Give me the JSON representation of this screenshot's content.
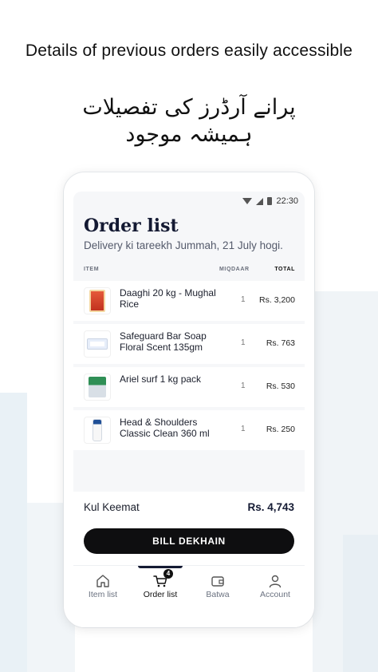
{
  "headline": {
    "english": "Details of previous orders easily accessible",
    "urdu_line1": "پرانے آرڈرز کی تفصیلات",
    "urdu_line2": "ہمیشہ موجود"
  },
  "status_bar": {
    "time": "22:30",
    "icons": [
      "wifi-icon",
      "cell-signal-icon",
      "battery-icon"
    ]
  },
  "screen": {
    "title": "Order list",
    "subtitle": "Delivery ki tareekh Jummah, 21 July hogi."
  },
  "table": {
    "headers": {
      "item": "ITEM",
      "qty": "MIQDAAR",
      "total": "TOTAL"
    },
    "rows": [
      {
        "name": "Daaghi 20 kg - Mughal Rice",
        "qty": "1",
        "price": "Rs. 3,200",
        "thumb_color": "#d9442f"
      },
      {
        "name": "Safeguard Bar Soap Floral Scent 135gm",
        "qty": "1",
        "price": "Rs. 763",
        "thumb_color": "#3f6fb5"
      },
      {
        "name": "Ariel surf 1 kg pack",
        "qty": "1",
        "price": "Rs. 530",
        "thumb_color": "#2f8f55"
      },
      {
        "name": "Head & Shoulders Classic Clean 360 ml",
        "qty": "1",
        "price": "Rs. 250",
        "thumb_color": "#2a5fa8"
      }
    ]
  },
  "footer": {
    "total_label": "Kul Keemat",
    "total_value": "Rs. 4,743",
    "button_label": "BILL DEKHAIN"
  },
  "tabs": [
    {
      "label": "Item list",
      "icon": "home-icon",
      "active": false
    },
    {
      "label": "Order list",
      "icon": "cart-icon",
      "active": true,
      "badge": "4"
    },
    {
      "label": "Batwa",
      "icon": "wallet-icon",
      "active": false
    },
    {
      "label": "Account",
      "icon": "user-icon",
      "active": false
    }
  ]
}
